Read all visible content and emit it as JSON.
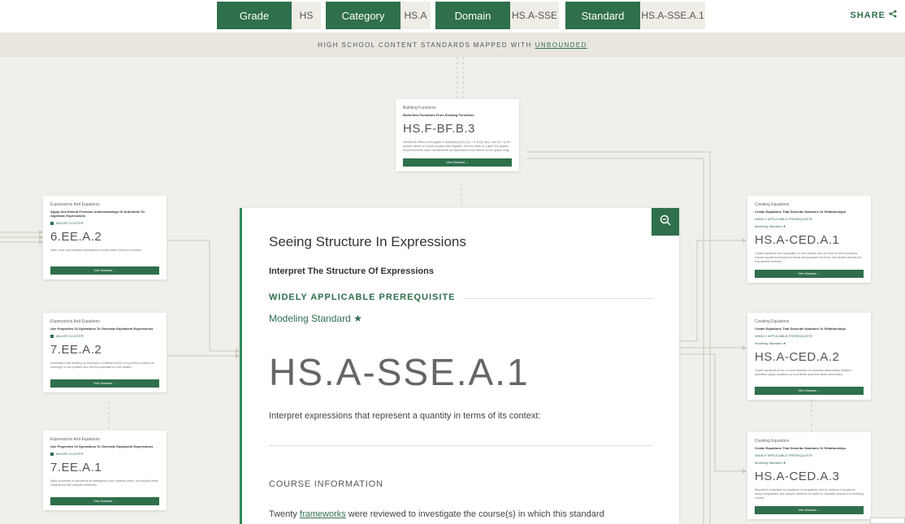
{
  "nav": {
    "grade_label": "Grade",
    "grade_value": "HS",
    "category_label": "Category",
    "category_value": "HS.A",
    "domain_label": "Domain",
    "domain_value": "HS.A-SSE",
    "standard_label": "Standard",
    "standard_value": "HS.A-SSE.A.1",
    "share": "SHARE"
  },
  "banner": {
    "text": "HIGH SCHOOL CONTENT STANDARDS MAPPED WITH",
    "link": "UNBOUNDED"
  },
  "cards": {
    "top": {
      "domain": "Building Functions",
      "cluster": "Build New Functions From Existing Functions",
      "code": "HS.F-BF.B.3",
      "desc": "Identify the effect on the graph of replacing f(x) by f(x) + k, k f(x), f(kx), and f(x + k) for specific values of k (both positive and negative); find the value of k given the graphs. Experiment with cases and illustrate an explanation of the effects on the graph using technology.",
      "btn": "View Standard →"
    },
    "l1": {
      "domain": "Expressions And Equations",
      "cluster": "Apply And Extend Previous Understandings Of Arithmetic To Algebraic Expressions",
      "tag": "MAJOR CLUSTER",
      "code": "6.EE.A.2",
      "desc": "Write, read, and evaluate expressions in which letters stand for numbers.",
      "btn": "View Standard →"
    },
    "l2": {
      "domain": "Expressions And Equations",
      "cluster": "Use Properties Of Operations To Generate Equivalent Expressions",
      "tag": "MAJOR CLUSTER",
      "code": "7.EE.A.2",
      "desc": "Understand that rewriting an expression in different forms in a problem context can shed light on the problem and how the quantities in it are related.",
      "btn": "View Standard →"
    },
    "l3": {
      "domain": "Expressions And Equations",
      "cluster": "Use Properties Of Operations To Generate Equivalent Expressions",
      "tag": "MAJOR CLUSTER",
      "code": "7.EE.A.1",
      "desc": "Apply properties of operations as strategies to add, subtract, factor, and expand linear expressions with rational coefficients.",
      "btn": "View Standard →"
    },
    "r1": {
      "domain": "Creating Equations",
      "cluster": "Create Equations That Describe Numbers Or Relationships",
      "tag": "WIDELY APPLICABLE PREREQUISITE",
      "tag2": "Modeling Standard ★",
      "code": "HS.A-CED.A.1",
      "desc": "Create equations and inequalities in one variable and use them to solve problems. Include equations arising from linear and quadratic functions, and simple rational and exponential functions.",
      "btn": "View Standard →"
    },
    "r2": {
      "domain": "Creating Equations",
      "cluster": "Create Equations That Describe Numbers Or Relationships",
      "tag": "WIDELY APPLICABLE PREREQUISITE",
      "tag2": "Modeling Standard ★",
      "code": "HS.A-CED.A.2",
      "desc": "Create equations in two or more variables to represent relationships between quantities; graph equations on coordinate axes with labels and scales.",
      "btn": "View Standard →"
    },
    "r3": {
      "domain": "Creating Equations",
      "cluster": "Create Equations That Describe Numbers Or Relationships",
      "tag": "WIDELY APPLICABLE PREREQUISITE",
      "tag2": "Modeling Standard ★",
      "code": "HS.A-CED.A.3",
      "desc": "Represent constraints by equations or inequalities, and by systems of equations and/or inequalities, and interpret solutions as viable or nonviable options in a modeling context.",
      "btn": "View Standard →"
    }
  },
  "main": {
    "title": "Seeing Structure In Expressions",
    "subtitle": "Interpret The Structure Of Expressions",
    "wap": "WIDELY APPLICABLE PREREQUISITE",
    "modeling": "Modeling Standard ★",
    "code": "HS.A-SSE.A.1",
    "description": "Interpret expressions that represent a quantity in terms of its context:",
    "course_heading": "COURSE INFORMATION",
    "frame_pre": "Twenty ",
    "frame_link": "frameworks",
    "frame_post": " were reviewed to investigate the course(s) in which this standard"
  }
}
